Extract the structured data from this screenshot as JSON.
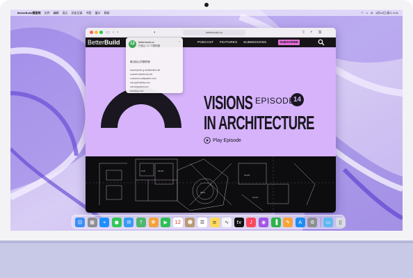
{
  "menubar": {
    "apple": "",
    "app_name": "BetterBuild播客频",
    "items": [
      "文件",
      "编辑",
      "显示",
      "历史记录",
      "书签",
      "窗口",
      "帮助"
    ],
    "date_time": "4月12日 周二 9:41"
  },
  "browser": {
    "url": "betterbuild.co",
    "site": {
      "logo_light": "Better",
      "logo_bold": "Build",
      "nav": [
        "PODCAST",
        "FEATURES",
        "SUBMISSIONS"
      ],
      "subscribe_label": "SUBSCRIBE",
      "hero_line1": "VISIONS",
      "hero_line2": "IN ARCHITECTURE",
      "episode_label": "EPISODE",
      "episode_number": "14",
      "play_label": "Play Episode"
    }
  },
  "notification": {
    "badge": "12",
    "site_name": "betterbuild.co",
    "message": "已阻止 12 个跟踪器",
    "close": "×",
    "section": "最近阻止的跟踪器",
    "trackers": [
      "securepixel.g.doubleclick.net",
      "connect.facebook.net",
      "s.amazon-adsystem.com",
      "cdn.optimizely.com",
      "cdn.segment.com",
      "bat.bing.com"
    ]
  },
  "dock": {
    "apps": [
      {
        "name": "Finder",
        "icon": "finder-icon",
        "glyph": "☺",
        "color": "#3b8df5"
      },
      {
        "name": "Launchpad",
        "icon": "launchpad-icon",
        "glyph": "▦",
        "color": "#8e8e93"
      },
      {
        "name": "Safari",
        "icon": "safari-icon",
        "glyph": "⌖",
        "color": "#1f8fff"
      },
      {
        "name": "Messages",
        "icon": "messages-icon",
        "glyph": "●",
        "color": "#34c759"
      },
      {
        "name": "Mail",
        "icon": "mail-icon",
        "glyph": "✉",
        "color": "#3a9bf5"
      },
      {
        "name": "Maps",
        "icon": "maps-icon",
        "glyph": "↑",
        "color": "#4fb66f"
      },
      {
        "name": "Photos",
        "icon": "photos-icon",
        "glyph": "❁",
        "color": "#f2a33c"
      },
      {
        "name": "FaceTime",
        "icon": "facetime-icon",
        "glyph": "▶",
        "color": "#2fbf57"
      },
      {
        "name": "Calendar",
        "icon": "calendar-icon",
        "glyph": "12",
        "color": "#ffffff"
      },
      {
        "name": "Contacts",
        "icon": "contacts-icon",
        "glyph": "☻",
        "color": "#b99a72"
      },
      {
        "name": "Reminders",
        "icon": "reminders-icon",
        "glyph": "☰",
        "color": "#ffffff"
      },
      {
        "name": "Notes",
        "icon": "notes-icon",
        "glyph": "≡",
        "color": "#ffd95a"
      },
      {
        "name": "Freeform",
        "icon": "freeform-icon",
        "glyph": "∿",
        "color": "#f5f5f7"
      },
      {
        "name": "Apple TV",
        "icon": "tv-icon",
        "glyph": "tv",
        "color": "#111111"
      },
      {
        "name": "Music",
        "icon": "music-icon",
        "glyph": "♪",
        "color": "#fa4a5f"
      },
      {
        "name": "Podcasts",
        "icon": "podcasts-icon",
        "glyph": "◉",
        "color": "#a157e5"
      },
      {
        "name": "Numbers",
        "icon": "numbers-icon",
        "glyph": "▐",
        "color": "#2cb34a"
      },
      {
        "name": "Pages",
        "icon": "pages-icon",
        "glyph": "✎",
        "color": "#f7a43b"
      },
      {
        "name": "App Store",
        "icon": "app-store-icon",
        "glyph": "A",
        "color": "#1e8cf2"
      },
      {
        "name": "System Settings",
        "icon": "settings-icon",
        "glyph": "⚙",
        "color": "#8e8e93"
      },
      {
        "name": "Downloads",
        "icon": "downloads-folder-icon",
        "glyph": "▭",
        "color": "#5fb8f0"
      },
      {
        "name": "Trash",
        "icon": "trash-icon",
        "glyph": "▯",
        "color": "#d9dbe2"
      }
    ]
  },
  "colors": {
    "site_bg": "#d6b3fb",
    "subscribe": "#e36dd9",
    "ink": "#1a1720",
    "chin": "#c7c9e6"
  }
}
